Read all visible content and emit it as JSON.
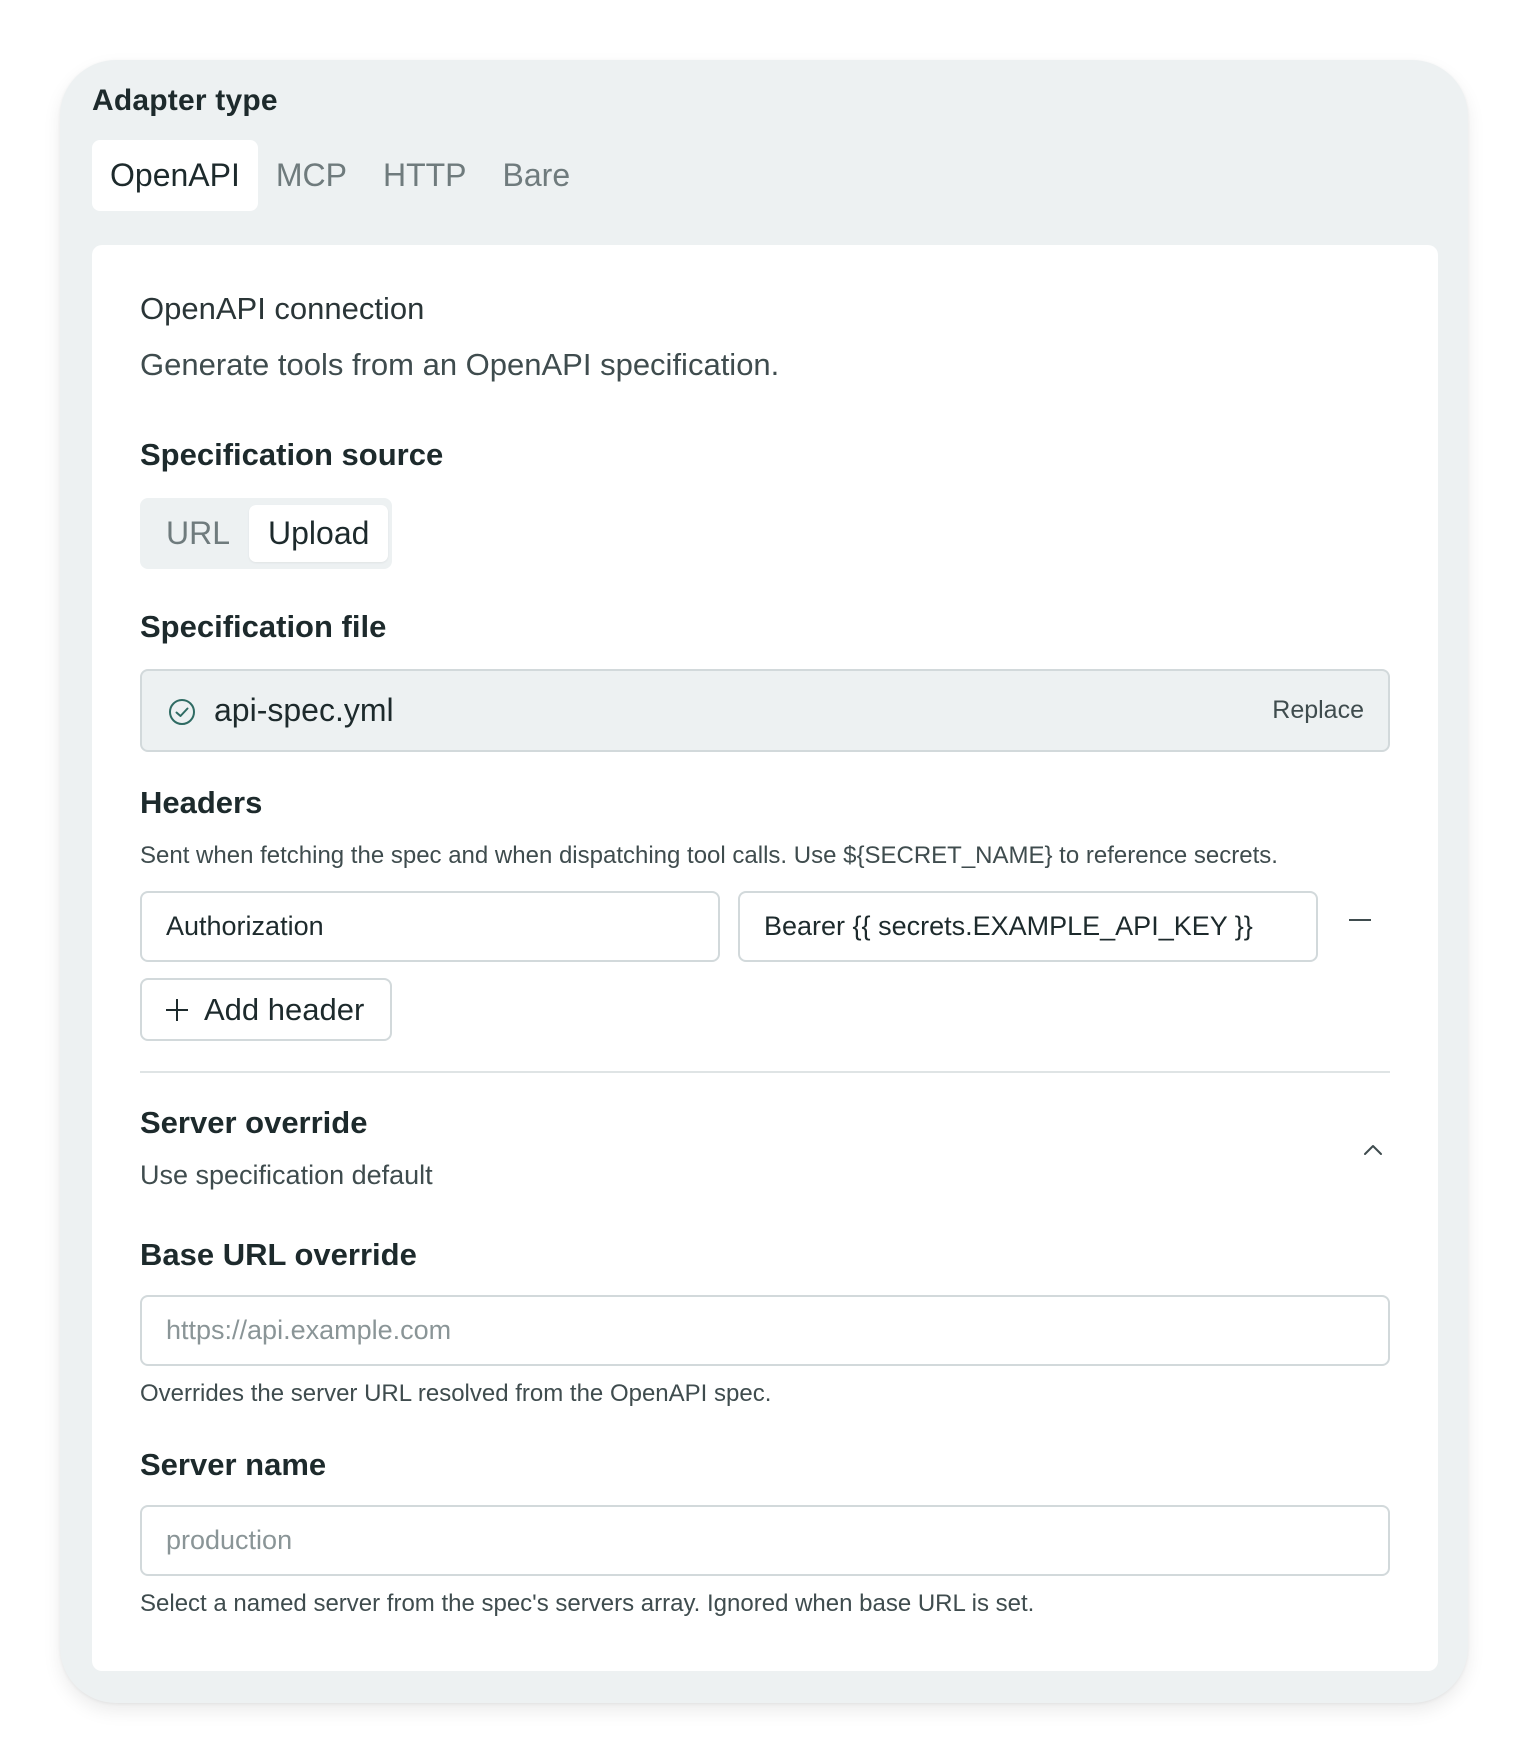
{
  "adapter": {
    "label": "Adapter type",
    "tabs": [
      {
        "label": "OpenAPI",
        "active": true
      },
      {
        "label": "MCP",
        "active": false
      },
      {
        "label": "HTTP",
        "active": false
      },
      {
        "label": "Bare",
        "active": false
      }
    ]
  },
  "connection": {
    "title": "OpenAPI connection",
    "description": "Generate tools from an OpenAPI specification."
  },
  "spec_source": {
    "label": "Specification source",
    "options": [
      {
        "label": "URL",
        "active": false
      },
      {
        "label": "Upload",
        "active": true
      }
    ]
  },
  "spec_file": {
    "label": "Specification file",
    "file_name": "api-spec.yml",
    "replace_label": "Replace",
    "status_icon": "check-circle-icon"
  },
  "headers": {
    "label": "Headers",
    "help": "Sent when fetching the spec and when dispatching tool calls. Use ${SECRET_NAME} to reference secrets.",
    "rows": [
      {
        "name": "Authorization",
        "value": "Bearer {{ secrets.EXAMPLE_API_KEY }}"
      }
    ],
    "add_label": "Add header"
  },
  "server_override": {
    "title": "Server override",
    "subtitle": "Use specification default",
    "expanded": true
  },
  "base_url": {
    "label": "Base URL override",
    "placeholder": "https://api.example.com",
    "help": "Overrides the server URL resolved from the OpenAPI spec."
  },
  "server_name": {
    "label": "Server name",
    "placeholder": "production",
    "help": "Select a named server from the spec's servers array. Ignored when base URL is set."
  },
  "colors": {
    "background": "#edf1f2",
    "panel": "#ffffff",
    "text": "#1d2a2c",
    "muted": "#6f7b7d",
    "border": "#d2d9db",
    "success": "#2f6b63"
  }
}
